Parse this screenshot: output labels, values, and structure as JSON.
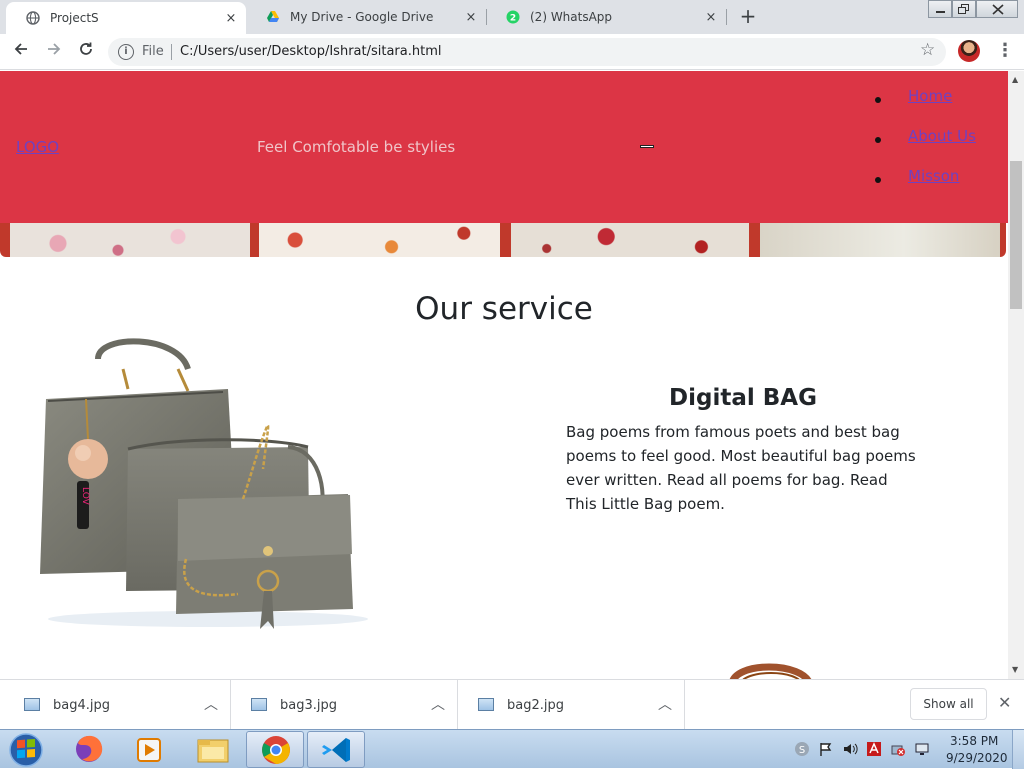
{
  "browser": {
    "tabs": [
      {
        "title": "ProjectS",
        "icon": "globe-icon",
        "active": true
      },
      {
        "title": "My Drive - Google Drive",
        "icon": "google-drive-icon",
        "active": false
      },
      {
        "title": "(2) WhatsApp",
        "icon": "whatsapp-icon",
        "active": false,
        "badge": "2"
      }
    ],
    "new_tab_icon": "+",
    "close_tab_icon": "×",
    "address": {
      "scheme_label": "File",
      "url": "C:/Users/user/Desktop/Ishrat/sitara.html"
    }
  },
  "site": {
    "header": {
      "logo": "LOGO",
      "tagline": "Feel Comfotable be stylies",
      "nav": [
        "Home",
        "About Us",
        "Misson"
      ]
    },
    "service": {
      "title": "Our service",
      "card_title": "Digital BAG",
      "card_text": "Bag poems from famous poets and best bag poems to feel good. Most beautiful bag poems ever written. Read all poems for bag. Read This Little Bag poem."
    }
  },
  "downloads": {
    "items": [
      "bag4.jpg",
      "bag3.jpg",
      "bag2.jpg"
    ],
    "show_all": "Show all"
  },
  "taskbar": {
    "apps": [
      "start-orb-icon",
      "firefox-icon",
      "media-player-icon",
      "file-explorer-icon",
      "chrome-icon",
      "vscode-icon"
    ],
    "clock_time": "3:58 PM",
    "clock_date": "9/29/2020"
  },
  "colors": {
    "header_bg": "#dc3545",
    "link": "#6f42c1",
    "chrome_tabstrip": "#dee1e6",
    "taskbar": "#b9d1ea"
  }
}
